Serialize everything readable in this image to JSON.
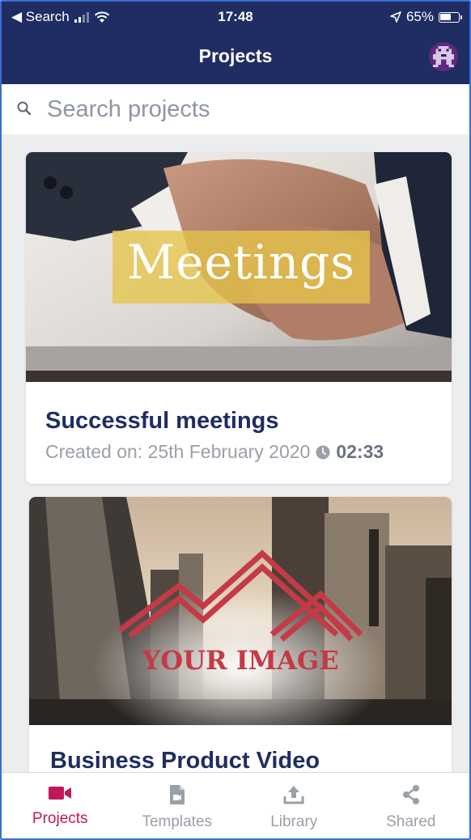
{
  "status_bar": {
    "back_label": "◀ Search",
    "time": "17:48",
    "battery": "65%",
    "battery_level": 0.65
  },
  "nav": {
    "title": "Projects",
    "avatar_icon": "pixel-avatar-icon"
  },
  "search": {
    "placeholder": "Search projects",
    "value": ""
  },
  "projects": [
    {
      "thumbnail_text": "Meetings",
      "title": "Successful meetings",
      "created": "Created on: 25th February 2020",
      "duration": "02:33"
    },
    {
      "thumbnail_text": "YOUR IMAGE",
      "title": "Business Product Video"
    }
  ],
  "tabs": [
    {
      "label": "Projects",
      "icon": "video-camera-icon",
      "active": true
    },
    {
      "label": "Templates",
      "icon": "template-file-icon",
      "active": false
    },
    {
      "label": "Library",
      "icon": "upload-icon",
      "active": false
    },
    {
      "label": "Shared",
      "icon": "share-icon",
      "active": false
    }
  ],
  "colors": {
    "nav_background": "#1f2d63",
    "accent": "#c2185b",
    "title_text": "#1f2d63"
  }
}
